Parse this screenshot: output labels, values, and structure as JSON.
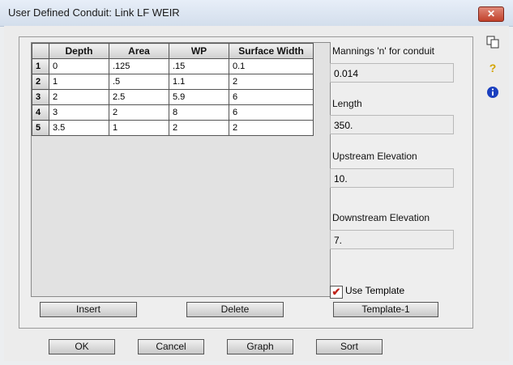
{
  "window": {
    "title": "User Defined Conduit: Link LF WEIR",
    "close_label": "✕"
  },
  "table": {
    "columns": [
      "Depth",
      "Area",
      "WP",
      "Surface Width"
    ],
    "rows": [
      {
        "index": "1",
        "cells": [
          "0",
          ".125",
          ".15",
          "0.1"
        ]
      },
      {
        "index": "2",
        "cells": [
          "1",
          ".5",
          "1.1",
          "2"
        ]
      },
      {
        "index": "3",
        "cells": [
          "2",
          "2.5",
          "5.9",
          "6"
        ]
      },
      {
        "index": "4",
        "cells": [
          "3",
          "2",
          "8",
          "6"
        ]
      },
      {
        "index": "5",
        "cells": [
          "3.5",
          "1",
          "2",
          "2"
        ]
      }
    ]
  },
  "fields": {
    "mannings_label": "Mannings 'n' for conduit",
    "mannings_value": "0.014",
    "length_label": "Length",
    "length_value": "350.",
    "upstream_label": "Upstream Elevation",
    "upstream_value": "10.",
    "downstream_label": "Downstream Elevation",
    "downstream_value": "7."
  },
  "template": {
    "use_template_label": "Use Template",
    "use_template_checked": true,
    "template_button": "Template-1"
  },
  "buttons": {
    "insert": "Insert",
    "delete": "Delete",
    "ok": "OK",
    "cancel": "Cancel",
    "graph": "Graph",
    "sort": "Sort"
  },
  "sidebar_icons": [
    "copy-icon",
    "help-icon",
    "info-icon"
  ]
}
